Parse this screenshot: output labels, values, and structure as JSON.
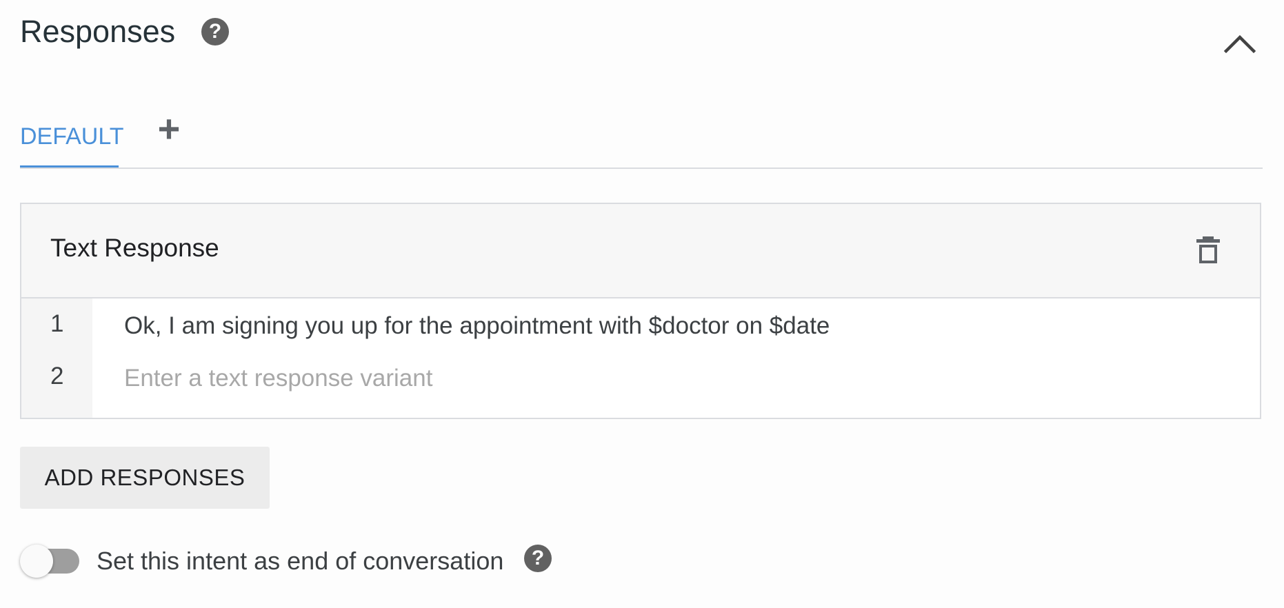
{
  "header": {
    "title": "Responses",
    "help_icon": "help-circle-icon",
    "collapse_icon": "chevron-up-icon"
  },
  "tabs": {
    "items": [
      {
        "label": "DEFAULT",
        "active": true
      }
    ],
    "add_label": "+"
  },
  "text_response": {
    "title": "Text Response",
    "delete_icon": "trash-icon",
    "rows": [
      {
        "number": "1",
        "value": "Ok, I am signing you up for the appointment with $doctor on $date"
      },
      {
        "number": "2",
        "value": "",
        "placeholder": "Enter a text response variant"
      }
    ]
  },
  "actions": {
    "add_responses_label": "ADD RESPONSES"
  },
  "end_of_conversation": {
    "label": "Set this intent as end of conversation",
    "enabled": false,
    "help_icon": "help-circle-icon"
  },
  "colors": {
    "accent": "#4a90d9",
    "icon_gray": "#616161",
    "toggle_off": "#9e9e9e",
    "button_bg": "#ececec"
  }
}
